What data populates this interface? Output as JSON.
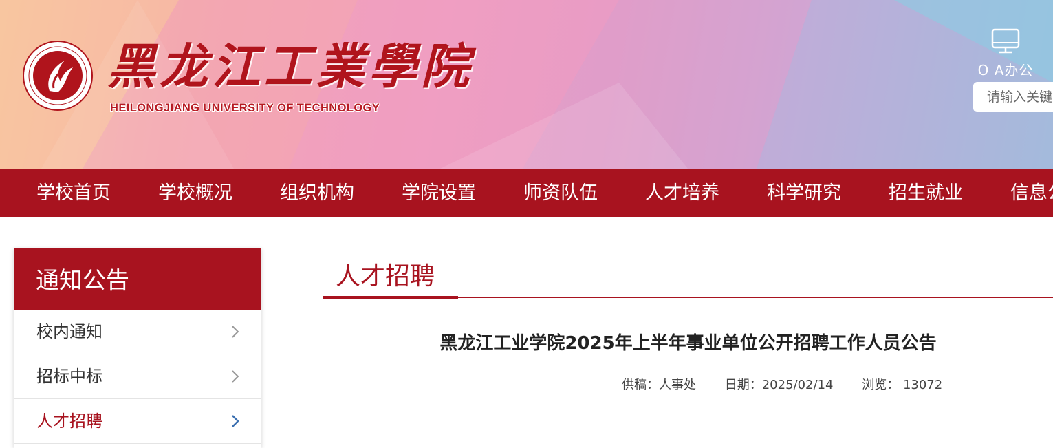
{
  "header": {
    "logo_cn": "黑龙江工業學院",
    "logo_en": "HEILONGJIANG UNIVERSITY OF TECHNOLOGY",
    "oa_label": "O A办公",
    "search_placeholder": "请输入关键"
  },
  "nav": {
    "items": [
      "学校首页",
      "学校概况",
      "组织机构",
      "学院设置",
      "师资队伍",
      "人才培养",
      "科学研究",
      "招生就业",
      "信息公"
    ]
  },
  "sidebar": {
    "title": "通知公告",
    "items": [
      {
        "label": "校内通知",
        "active": false
      },
      {
        "label": "招标中标",
        "active": false
      },
      {
        "label": "人才招聘",
        "active": true
      }
    ]
  },
  "main": {
    "section_title": "人才招聘",
    "article_title": "黑龙江工业学院2025年上半年事业单位公开招聘工作人员公告",
    "meta": {
      "source": "供稿：人事处",
      "date": "日期：2025/02/14",
      "views": "浏览： 13072"
    }
  },
  "colors": {
    "brand_red": "#a8131f",
    "active_chevron": "#3a6fb0"
  }
}
